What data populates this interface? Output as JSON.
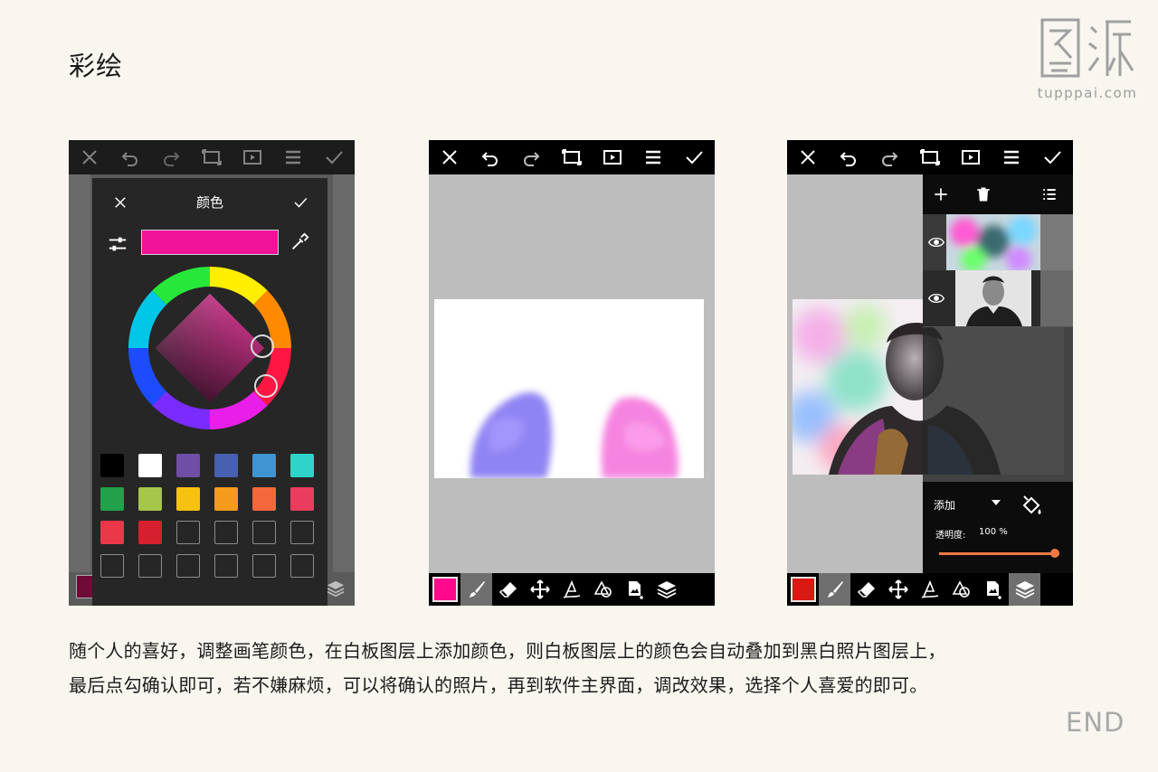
{
  "page": {
    "title": "彩绘",
    "logo_url": "tupppai.com",
    "description_line1": "随个人的喜好，调整画笔颜色，在白板图层上添加颜色，则白板图层上的颜色会自动叠加到黑白照片图层上，",
    "description_line2": "最后点勾确认即可，若不嫌麻烦，可以将确认的照片，再到软件主界面，调改效果，选择个人喜爱的即可。",
    "end_label": "END"
  },
  "toolbar_icons": [
    "close-icon",
    "undo-icon",
    "redo-icon",
    "crop-icon",
    "play-icon",
    "menu-icon",
    "check-icon"
  ],
  "bottom_icons": [
    "brush-icon",
    "eraser-icon",
    "move-icon",
    "text-icon",
    "shapes-icon",
    "image-add-icon",
    "layers-icon"
  ],
  "color_dialog": {
    "title": "颜色",
    "current_color": "#f0139a",
    "palette": [
      "#000000",
      "#ffffff",
      "#6f4ea6",
      "#4860b0",
      "#3e95d1",
      "#2fd3c8",
      "#22a14a",
      "#a5c64a",
      "#f7c10f",
      "#f49a1d",
      "#f4673c",
      "#ea3d5e",
      "#ea3848",
      "#d6202f",
      "",
      "",
      "",
      "",
      "",
      "",
      "",
      "",
      "",
      ""
    ]
  },
  "panel2": {
    "brush_color": "#ff0a8c"
  },
  "panel3": {
    "brush_color": "#d81a12",
    "blend_mode": "添加",
    "opacity_label": "透明度:",
    "opacity_value": "100 %",
    "opacity_fraction": 1.0,
    "accent_color": "#f07a44"
  }
}
